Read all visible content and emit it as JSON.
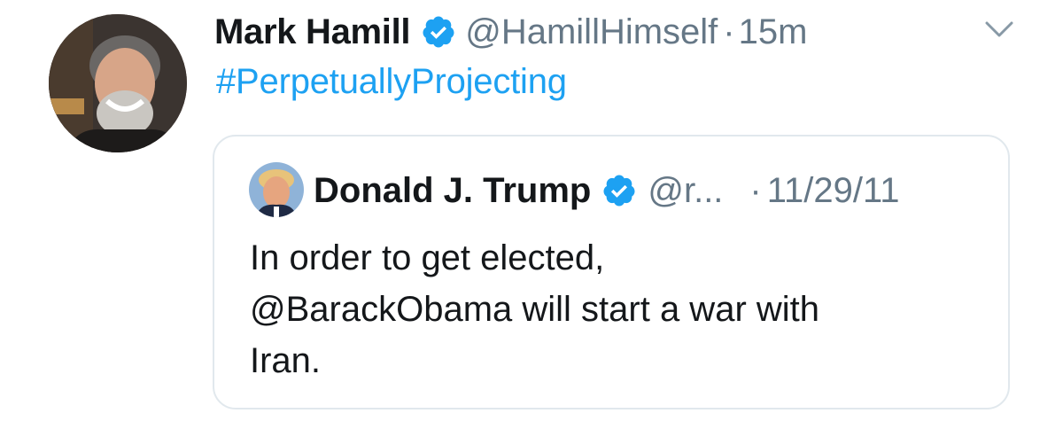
{
  "tweet": {
    "author": {
      "name": "Mark Hamill",
      "handle": "@HamillHimself",
      "verified": true,
      "avatar_icon": "profile-photo-icon"
    },
    "separator": "·",
    "timestamp": "15m",
    "text": "#PerpetuallyProjecting",
    "menu_icon": "chevron-down-icon",
    "quoted": {
      "author": {
        "name": "Donald J. Trump",
        "handle": "@r...",
        "verified": true,
        "avatar_icon": "profile-photo-icon"
      },
      "separator": "·",
      "timestamp": "11/29/11",
      "text_lines": [
        "In order to get elected,",
        "@BarackObama will start a war with",
        "Iran."
      ]
    }
  },
  "colors": {
    "link": "#1da1f2",
    "secondary_text": "#657786",
    "primary_text": "#14171a",
    "border": "#e1e8ed",
    "verified_badge": "#1da1f2"
  }
}
